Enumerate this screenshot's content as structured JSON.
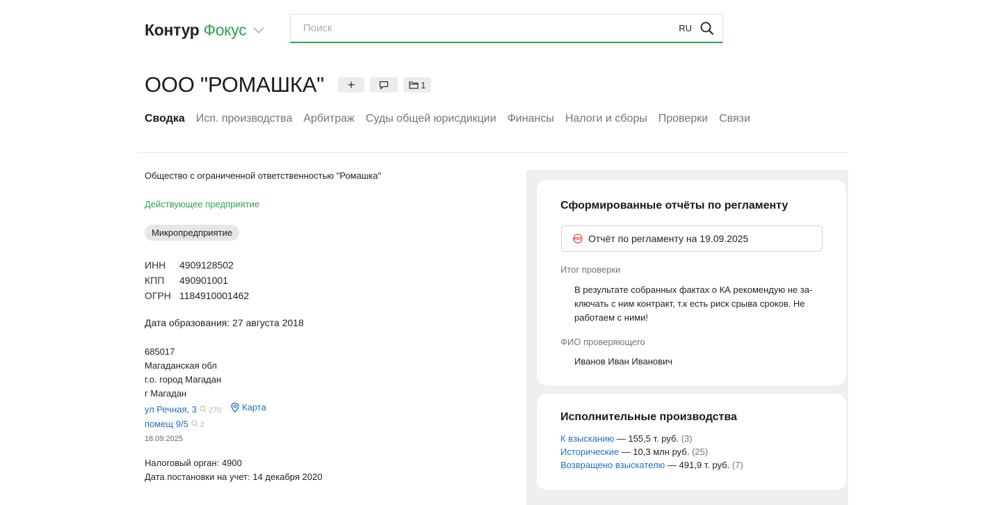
{
  "header": {
    "logo_part1": "Контур",
    "logo_part2": "Фокус",
    "search_placeholder": "Поиск",
    "search_lang": "RU"
  },
  "company": {
    "title": "ООО \"РОМАШКА\"",
    "plus_label": "+",
    "folder_count": "1"
  },
  "tabs": [
    {
      "label": "Сводка",
      "active": true
    },
    {
      "label": "Исп. производства"
    },
    {
      "label": "Арбитраж"
    },
    {
      "label": "Суды общей юрисдикции"
    },
    {
      "label": "Финансы"
    },
    {
      "label": "Налоги и сборы"
    },
    {
      "label": "Проверки"
    },
    {
      "label": "Связи"
    }
  ],
  "summary": {
    "full_name": "Общество с ограниченной ответственностью \"Ромашка\"",
    "status": "Действующее предприятие",
    "size_badge": "Микропредприятие",
    "requisites": [
      {
        "key": "ИНН",
        "value": "4909128502"
      },
      {
        "key": "КПП",
        "value": "490901001"
      },
      {
        "key": "ОГРН",
        "value": "1184910001462"
      }
    ],
    "reg_date": "Дата образования: 27 августа 2018",
    "address": {
      "zip": "685017",
      "region": "Магаданская обл",
      "district": "г.о. город Магадан",
      "city": "г Магадан",
      "street": "ул Речная, 3",
      "street_count": "270",
      "map_label": "Карта",
      "room": "помещ 9/5",
      "room_count": "2",
      "date": "18.09.2025"
    },
    "tax_authority": "Налоговый орган: 4900",
    "tax_reg_date": "Дата постановки на учет: 14 декабря 2020"
  },
  "reports_card": {
    "title": "Сформированные отчёты по регламенту",
    "report_button": "Отчёт по регламенту на 19.09.2025",
    "result_label": "Итог проверки",
    "result_text": "В результате собранных фактах о КА рекомендую не за-ключать с ним контракт, т.к есть риск срыва сроков. Не работаем с ними!",
    "inspector_label": "ФИО проверяющего",
    "inspector_name": "Иванов Иван Иванович"
  },
  "enforcement_card": {
    "title": "Исполнительные производства",
    "items": [
      {
        "link": "К взысканию",
        "text": " — 155,5 т. руб.",
        "count": "(3)"
      },
      {
        "link": "Исторические",
        "text": " — 10,3 млн руб.",
        "count": "(25)"
      },
      {
        "link": "Возвращено взыскателю",
        "text": " — 491,9 т. руб.",
        "count": "(7)"
      }
    ]
  },
  "colors": {
    "brand_green": "#2fa24a",
    "link_blue": "#1f6fc5",
    "pdf_red": "#e03a3a"
  }
}
